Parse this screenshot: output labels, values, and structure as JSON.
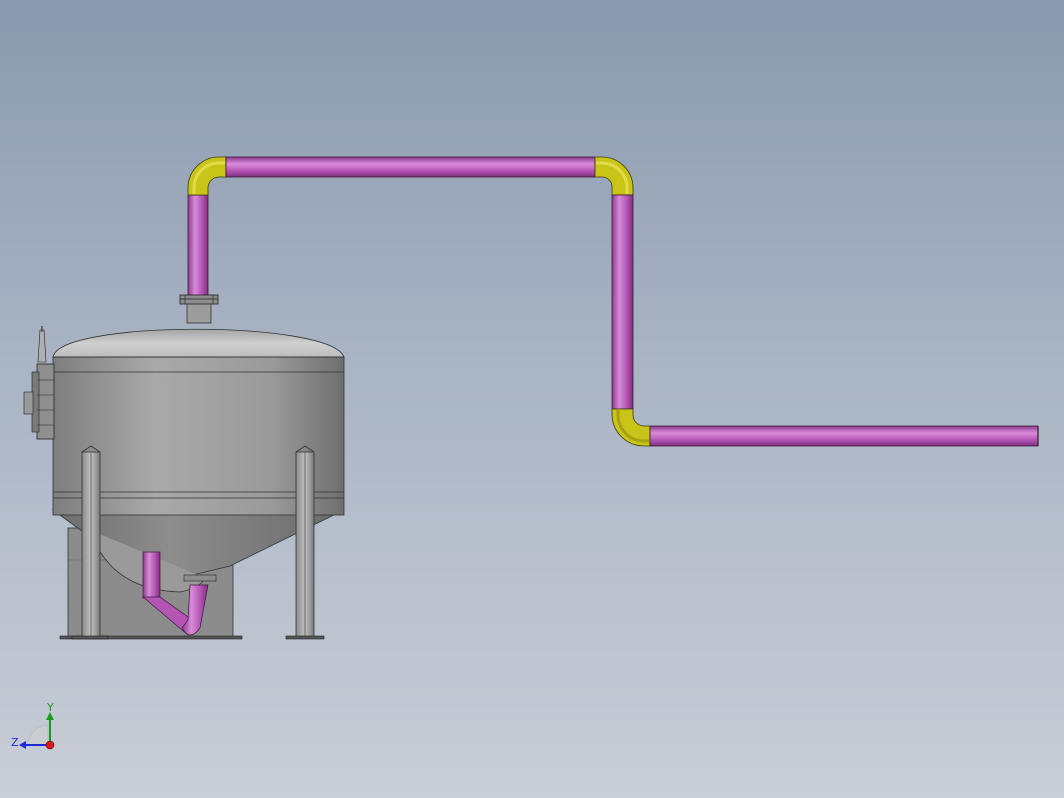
{
  "scene": {
    "background_top": "#8a99ae",
    "background_bottom": "#c9ced7"
  },
  "colors": {
    "pipe": "#b455b4",
    "pipe_highlight": "#d98bd9",
    "pipe_shadow": "#7d2f7d",
    "elbow": "#c8c418",
    "elbow_highlight": "#e7e357",
    "elbow_shadow": "#8f8b0c",
    "vessel": "#9a9a9a",
    "vessel_light": "#c4c4c4",
    "vessel_dark": "#666666",
    "outline": "#2b2b2b"
  },
  "triad": {
    "y_label": "Y",
    "z_label": "Z",
    "y_color": "#1a9a1a",
    "z_color": "#1f2bd6",
    "x_color": "#d41a1a"
  }
}
